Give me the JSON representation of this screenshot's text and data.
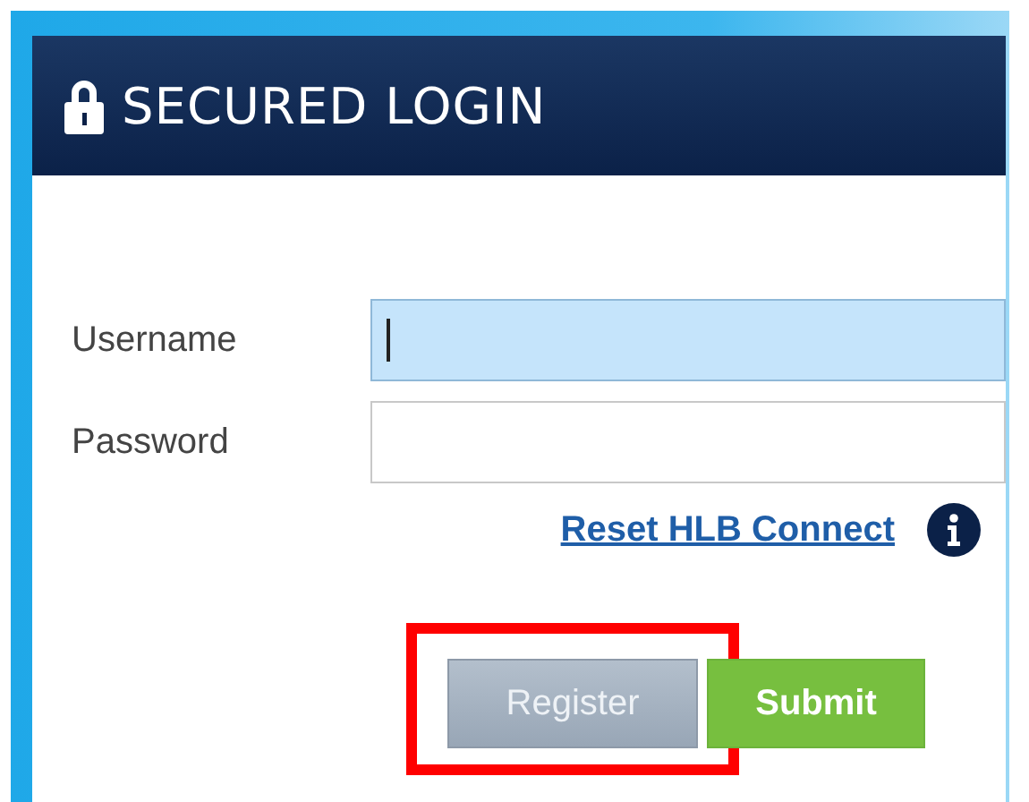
{
  "header": {
    "title": "SECURED LOGIN"
  },
  "fields": [
    {
      "label": "Username",
      "focused": true
    },
    {
      "label": "Password",
      "focused": false
    }
  ],
  "reset_link": "Reset HLB Connect",
  "buttons": [
    {
      "kind": "secondary",
      "label": "Register",
      "highlighted": true
    },
    {
      "kind": "primary",
      "label": "Submit",
      "highlighted": false
    }
  ]
}
